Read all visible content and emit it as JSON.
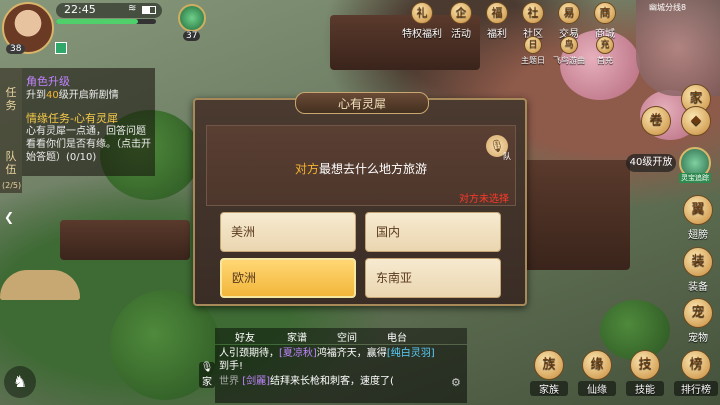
{
  "status": {
    "time": "22:45",
    "wifi": "wifi-icon",
    "battery": "battery-icon"
  },
  "player": {
    "level": "38",
    "hp_fraction": 0.82,
    "pet_level": "37"
  },
  "top_menu": [
    {
      "label": "特权福利",
      "icon": "gift-icon"
    },
    {
      "label": "活动",
      "icon": "penguin-icon"
    },
    {
      "label": "福利",
      "icon": "bag-icon"
    },
    {
      "label": "社区",
      "icon": "house-icon"
    },
    {
      "label": "交易",
      "icon": "coin-icon"
    },
    {
      "label": "商城",
      "icon": "shop-icon"
    }
  ],
  "sub_menu": [
    {
      "label": "主题日",
      "icon": "calendar-icon"
    },
    {
      "label": "飞鸟游曲",
      "icon": "bird-icon"
    },
    {
      "label": "首充",
      "icon": "chest-icon"
    }
  ],
  "minimap": {
    "label": "幽城分线8"
  },
  "side_tabs": {
    "tasks": "任务",
    "team": "队伍",
    "team_count": "(2/5)"
  },
  "quests": [
    {
      "title": "角色升级",
      "title_color": "#c184ff",
      "desc_before": "升到",
      "desc_level": "40",
      "desc_after": "级开启新剧情"
    },
    {
      "title": "情缘任务-心有灵犀",
      "title_color": "#f5c94a",
      "desc": "心有灵犀一点通，回答问题看看你们是否有缘。（点击开始答题）(0/10)"
    }
  ],
  "right_side": {
    "unlock_text": "40级开放",
    "unlock_tag": "灵宝追踪",
    "buttons": [
      {
        "label": "",
        "icon": "home-icon"
      },
      {
        "label": "",
        "icon": "grid-icon"
      },
      {
        "label": "翅膀",
        "icon": "wing-icon"
      },
      {
        "label": "装备",
        "icon": "equip-icon"
      },
      {
        "label": "宠物",
        "icon": "pet-icon"
      }
    ]
  },
  "dialog": {
    "title": "心有灵犀",
    "question_highlight": "对方",
    "question_rest": "最想去什么地方旅游",
    "mic_label": "队",
    "opponent_status": "对方未选择",
    "options": [
      {
        "label": "美洲",
        "selected": false
      },
      {
        "label": "国内",
        "selected": false
      },
      {
        "label": "欧洲",
        "selected": true
      },
      {
        "label": "东南亚",
        "selected": false
      }
    ]
  },
  "chat": {
    "tabs": [
      "好友",
      "家谱",
      "空间",
      "电台"
    ],
    "line1_a": "人引颈期待，",
    "line1_name1": "[夏凉秋]",
    "line1_b": "鸿福齐天，赢得",
    "line1_name2": "[纯白灵羽]",
    "line1_c": "到手!",
    "line2_channel": "世界",
    "line2_name": "[剑麗]",
    "line2_text": "结拜来长枪和刺客，速度了(",
    "voice_label": "家"
  },
  "bottom_bar": [
    {
      "label": "家族",
      "icon": "family-icon"
    },
    {
      "label": "仙缘",
      "icon": "fate-icon"
    },
    {
      "label": "技能",
      "icon": "skill-icon"
    },
    {
      "label": "排行榜",
      "icon": "rank-icon"
    }
  ]
}
